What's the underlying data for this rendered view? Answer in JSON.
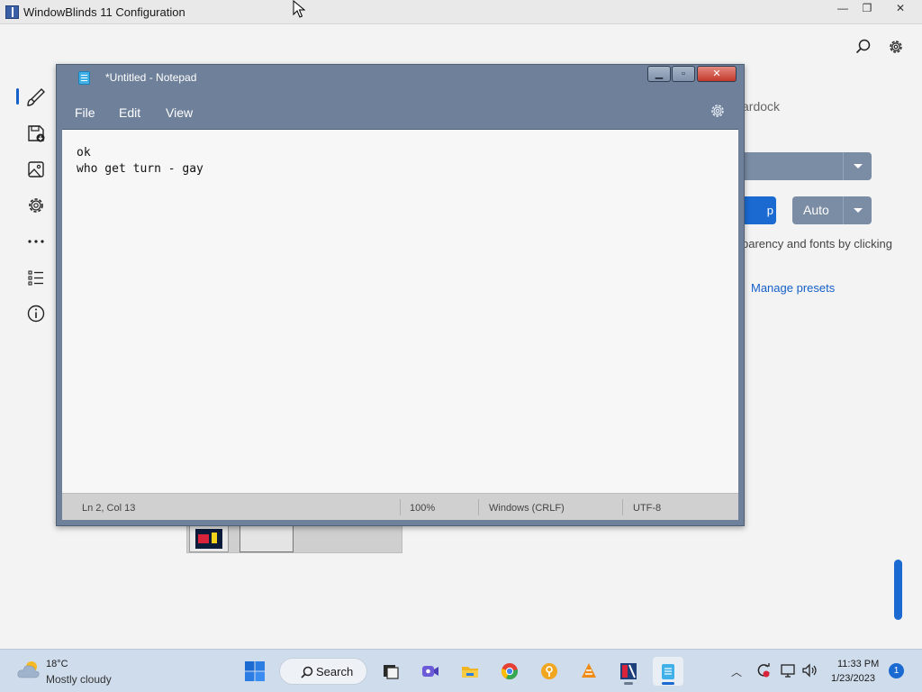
{
  "config_window": {
    "title": "WindowBlinds 11 Configuration",
    "controls": {
      "minimize": "—",
      "restore": "❐",
      "close": "✕"
    },
    "brand_fragment": "ardock",
    "apply_button_fragment": "p",
    "auto_button": "Auto",
    "description_fragment": "parency and fonts by clicking",
    "manage_presets": "Manage presets",
    "sidebar_icons": [
      "paintbrush-icon",
      "save-icon",
      "image-icon",
      "gear-icon",
      "more-icon",
      "list-icon",
      "info-icon"
    ],
    "accent_color": "#1a6ad2"
  },
  "notepad": {
    "title": "*Untitled - Notepad",
    "menu": [
      "File",
      "Edit",
      "View"
    ],
    "lines": [
      "ok",
      "who get turn - gay"
    ],
    "status": {
      "position": "Ln 2, Col 13",
      "zoom": "100%",
      "line_ending": "Windows (CRLF)",
      "encoding": "UTF-8"
    }
  },
  "taskbar": {
    "weather": {
      "temp": "18°C",
      "condition": "Mostly cloudy"
    },
    "search_label": "Search",
    "apps": [
      "windows-start-icon",
      "task-view-icon",
      "meet-icon",
      "file-explorer-icon",
      "chrome-icon",
      "keepass-icon",
      "vlc-icon",
      "windowblinds-icon",
      "notepad-icon"
    ],
    "clock": {
      "time": "11:33 PM",
      "date": "1/23/2023"
    },
    "notification_count": "1"
  }
}
